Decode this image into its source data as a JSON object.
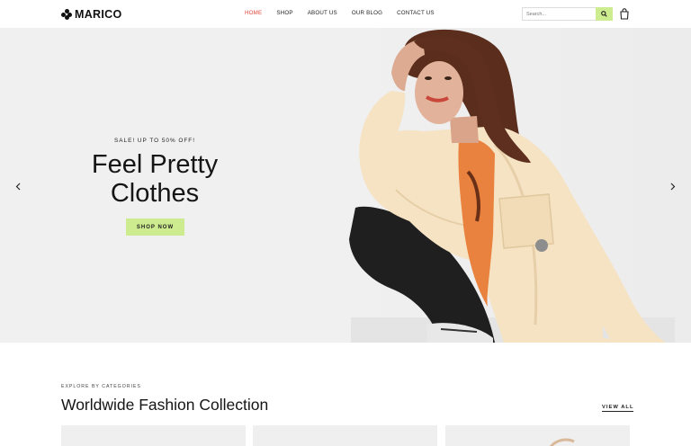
{
  "header": {
    "brand": "MARICO",
    "nav": [
      {
        "label": "HOME",
        "active": true
      },
      {
        "label": "SHOP",
        "active": false
      },
      {
        "label": "ABOUT US",
        "active": false
      },
      {
        "label": "OUR BLOG",
        "active": false
      },
      {
        "label": "CONTACT US",
        "active": false
      }
    ],
    "search_placeholder": "Search...",
    "icons": [
      "logo-icon",
      "search-icon",
      "cart-icon"
    ]
  },
  "hero": {
    "tag": "SALE! UP TO 50% OFF!",
    "title_line1": "Feel Pretty",
    "title_line2": "Clothes",
    "cta": "SHOP NOW",
    "icons": [
      "chevron-left-icon",
      "chevron-right-icon"
    ]
  },
  "categories": {
    "eyebrow": "EXPLORE BY CATEGORIES",
    "title": "Worldwide Fashion Collection",
    "view_all": "VIEW ALL"
  },
  "colors": {
    "accent": "#cdeb8f",
    "active_nav": "#e0463a",
    "hero_bg": "#f0f0f1",
    "jacket": "#f6e3c4",
    "shirt": "#e8823e",
    "pants": "#1d1d1d"
  }
}
